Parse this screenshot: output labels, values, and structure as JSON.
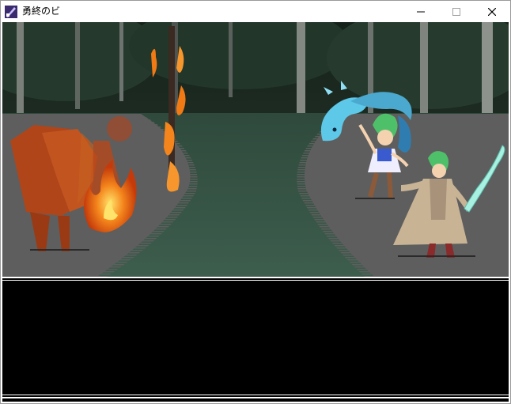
{
  "window": {
    "title": "勇終のビ",
    "icon": "game-app-icon",
    "controls": [
      "minimize-icon",
      "maximize-icon",
      "close-icon"
    ]
  },
  "battle": {
    "enemy": {
      "name": "",
      "icon": "fire-demon-silhouette"
    },
    "party": [
      {
        "name": "",
        "icon": "green-haired-girl-with-water-dragon"
      },
      {
        "name": "",
        "icon": "green-haired-swordsman"
      }
    ],
    "effects": [
      "fire-pillar",
      "flame-burst",
      "water-dragon-spell",
      "crystal-sword"
    ]
  },
  "message_window": {
    "text": ""
  },
  "colors": {
    "battle_floor": "#5e5e5e",
    "forest_dark": "#1e2b22",
    "fire": "#f27a14",
    "enemy": "#b0451a",
    "hair": "#4fc06a",
    "water": "#5ec8e8"
  }
}
